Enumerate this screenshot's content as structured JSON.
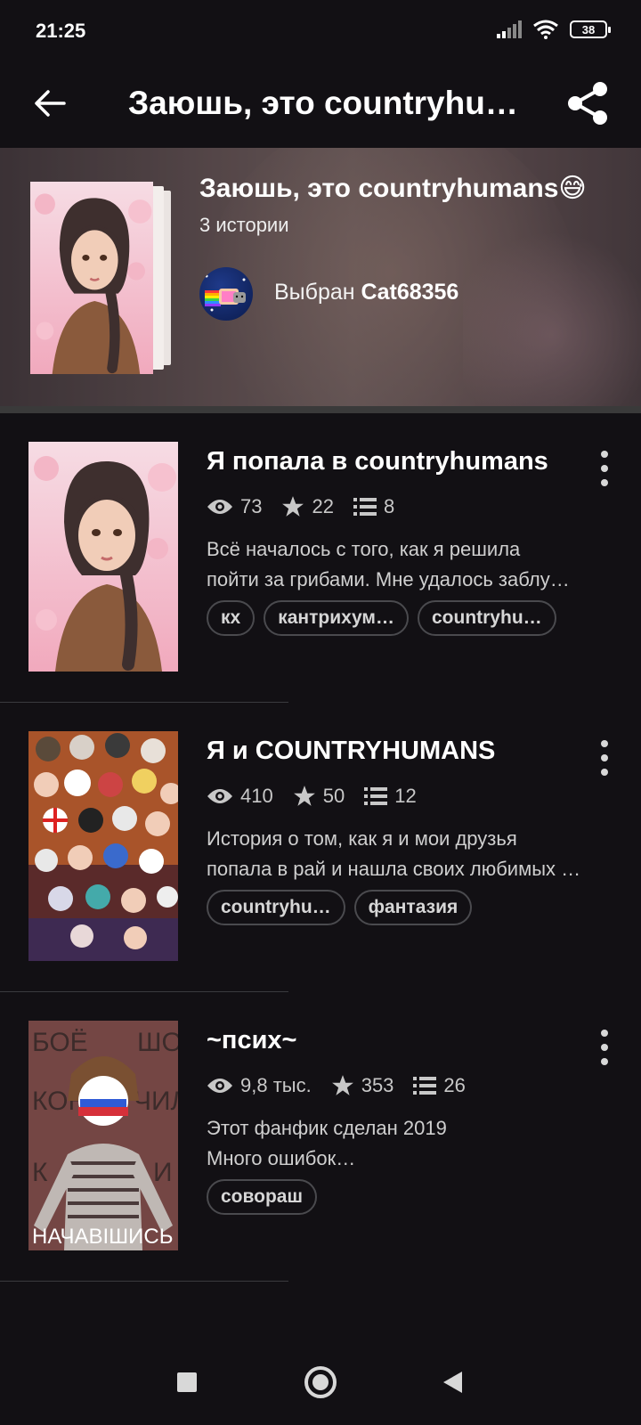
{
  "status_bar": {
    "time": "21:25",
    "battery": "38"
  },
  "app_bar": {
    "title": "Заюшь, это countryhumans😅",
    "back_icon": "arrow-left-icon",
    "share_icon": "share-icon"
  },
  "collection": {
    "title": "Заюшь, это countryhumans😅",
    "count": "3 истории",
    "picked_prefix": "Выбран",
    "picked_user": "Cat68356"
  },
  "stories": [
    {
      "title": "Я попала в countryhumans",
      "views": "73",
      "votes": "22",
      "parts": "8",
      "description": [
        "Всё началось с того, как я решила",
        "пойти за грибами. Мне удалось заблу…"
      ],
      "tags": [
        "кх",
        "кантрихум…",
        "countryhu…"
      ]
    },
    {
      "title": "Я и COUNTRYHUMANS",
      "views": "410",
      "votes": "50",
      "parts": "12",
      "description": [
        "История о том, как я и мои друзья",
        "попала в рай и нашла своих любимых …"
      ],
      "tags": [
        "countryhu…",
        "фантазия"
      ]
    },
    {
      "title": "~псих~",
      "views": "9,8 тыс.",
      "votes": "353",
      "parts": "26",
      "description": [
        "Этот фанфик сделан 2019",
        "Много ошибок…"
      ],
      "tags": [
        "совораш"
      ]
    }
  ],
  "cover3_text": {
    "left_top": "БОЁ",
    "left_mid": "КОН",
    "left_bot": "К",
    "right_top": "ШО",
    "right_mid": "ЧИЛ",
    "right_bot": "И",
    "bottom": "НАЧАВІШИСЬ"
  },
  "nav": {
    "recents_icon": "square-icon",
    "home_icon": "circle-icon",
    "back_icon": "triangle-back-icon"
  },
  "colors": {
    "background": "#121014",
    "text": "#ffffff",
    "muted": "#c8c8c8",
    "tag_border": "#4a4a4e"
  }
}
